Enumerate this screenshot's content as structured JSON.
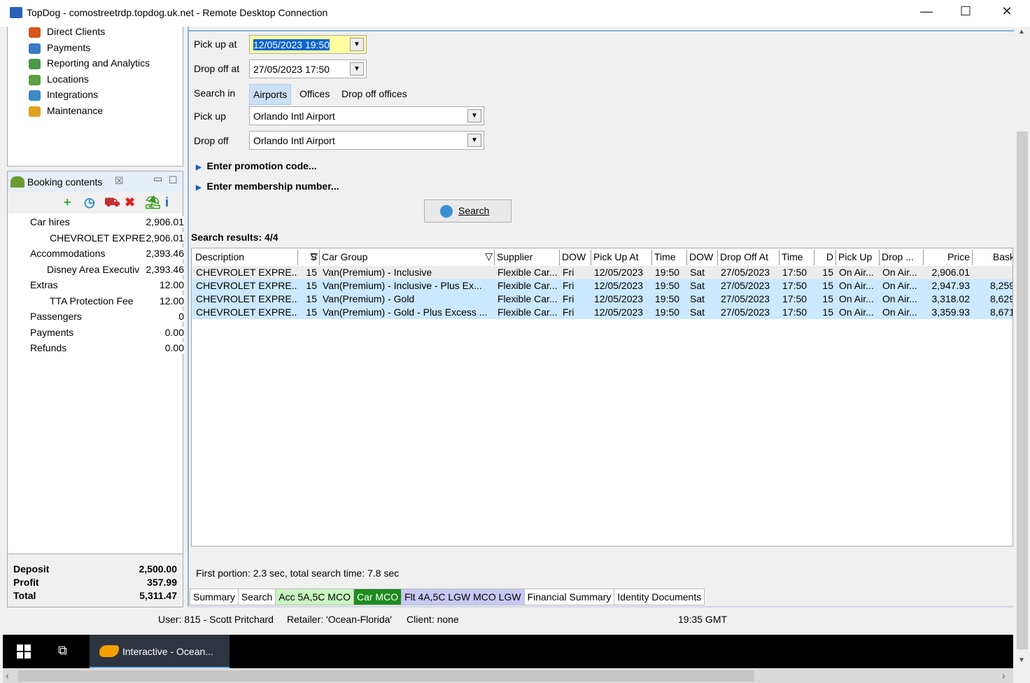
{
  "window": {
    "title": "TopDog - comostreetrdp.topdog.uk.net - Remote Desktop Connection",
    "minimize": "—",
    "maximize": "☐",
    "close": "✕"
  },
  "nav": {
    "items": [
      {
        "label": "Direct Clients",
        "icon": "people-icon",
        "color": "#d9541c"
      },
      {
        "label": "Payments",
        "icon": "payments-icon",
        "color": "#3a7cc2"
      },
      {
        "label": "Reporting and Analytics",
        "icon": "report-icon",
        "color": "#4a9a4a"
      },
      {
        "label": "Locations",
        "icon": "map-icon",
        "color": "#5aa040"
      },
      {
        "label": "Integrations",
        "icon": "globe-icon",
        "color": "#3a8ac8"
      },
      {
        "label": "Maintenance",
        "icon": "tools-icon",
        "color": "#e0a020"
      }
    ]
  },
  "booking": {
    "title": "Booking contents",
    "tools": [
      "add-icon",
      "clock-icon",
      "cart-icon",
      "delete-icon",
      "island-icon",
      "info-icon"
    ],
    "rows": [
      {
        "label": "Car hires",
        "value": "2,906.01",
        "indent": false
      },
      {
        "label": "CHEVROLET EXPRE",
        "value": "2,906.01",
        "indent": true
      },
      {
        "label": "Accommodations",
        "value": "2,393.46",
        "indent": false
      },
      {
        "label": "Disney Area Executiv",
        "value": "2,393.46",
        "indent": true
      },
      {
        "label": "Extras",
        "value": "12.00",
        "indent": false
      },
      {
        "label": "TTA Protection Fee",
        "value": "12.00",
        "indent": true
      },
      {
        "label": "Passengers",
        "value": "0",
        "indent": false
      },
      {
        "label": "Payments",
        "value": "0.00",
        "indent": false
      },
      {
        "label": "Refunds",
        "value": "0.00",
        "indent": false
      }
    ],
    "totals": [
      {
        "label": "Deposit",
        "value": "2,500.00"
      },
      {
        "label": "Profit",
        "value": "357.99"
      },
      {
        "label": "Total",
        "value": "5,311.47"
      }
    ]
  },
  "form": {
    "pickup_at_label": "Pick up at",
    "pickup_at": "12/05/2023 19:50",
    "dropoff_at_label": "Drop off at",
    "dropoff_at": "27/05/2023 17:50",
    "search_in_label": "Search in",
    "search_in_options": [
      "Airports",
      "Offices",
      "Drop off offices"
    ],
    "search_in_selected": "Airports",
    "pickup_label": "Pick up",
    "pickup": "Orlando Intl Airport",
    "dropoff_label": "Drop off",
    "dropoff": "Orlando Intl Airport",
    "promo": "Enter promotion code...",
    "membership": "Enter membership number...",
    "search_button": "Search"
  },
  "results": {
    "title": "Search results: 4/4",
    "columns": [
      "Description",
      "S",
      "Car Group",
      "Supplier",
      "DOW",
      "Pick Up At",
      "Time",
      "DOW",
      "Drop Off At",
      "Time",
      "D",
      "Pick Up",
      "Drop ...",
      "Price",
      "Bask"
    ],
    "rows": [
      [
        "CHEVROLET EXPRE...",
        "15",
        "Van(Premium) - Inclusive",
        "Flexible Car...",
        "Fri",
        "12/05/2023",
        "19:50",
        "Sat",
        "27/05/2023",
        "17:50",
        "15",
        "On Air...",
        "On Air...",
        "2,906.01",
        ""
      ],
      [
        "CHEVROLET EXPRE...",
        "15",
        "Van(Premium) - Inclusive - Plus Ex...",
        "Flexible Car...",
        "Fri",
        "12/05/2023",
        "19:50",
        "Sat",
        "27/05/2023",
        "17:50",
        "15",
        "On Air...",
        "On Air...",
        "2,947.93",
        "8,259"
      ],
      [
        "CHEVROLET EXPRE...",
        "15",
        "Van(Premium) - Gold",
        "Flexible Car...",
        "Fri",
        "12/05/2023",
        "19:50",
        "Sat",
        "27/05/2023",
        "17:50",
        "15",
        "On Air...",
        "On Air...",
        "3,318.02",
        "8,629"
      ],
      [
        "CHEVROLET EXPRE...",
        "15",
        "Van(Premium) - Gold - Plus Excess ...",
        "Flexible Car...",
        "Fri",
        "12/05/2023",
        "19:50",
        "Sat",
        "27/05/2023",
        "17:50",
        "15",
        "On Air...",
        "On Air...",
        "3,359.93",
        "8,671"
      ]
    ],
    "timing": "First portion: 2.3 sec, total search time: 7.8 sec"
  },
  "tabs": [
    {
      "label": "Summary",
      "bg": "#ffffff",
      "fg": "#000000"
    },
    {
      "label": "Search",
      "bg": "#ffffff",
      "fg": "#000000"
    },
    {
      "label": "Acc 5A,5C MCO",
      "bg": "#c8f5c0",
      "fg": "#000000"
    },
    {
      "label": "Car MCO",
      "bg": "#1e8a1e",
      "fg": "#ffffff"
    },
    {
      "label": "Flt 4A,5C LGW MCO LGW",
      "bg": "#c8c8f5",
      "fg": "#000000"
    },
    {
      "label": "Financial Summary",
      "bg": "#ffffff",
      "fg": "#000000"
    },
    {
      "label": "Identity Documents",
      "bg": "#ffffff",
      "fg": "#000000"
    }
  ],
  "status": {
    "user": "User: 815 - Scott Pritchard",
    "retailer": "Retailer: 'Ocean-Florida'",
    "client": "Client: none",
    "time": "19:35 GMT"
  },
  "taskbar": {
    "app": "Interactive - Ocean..."
  }
}
